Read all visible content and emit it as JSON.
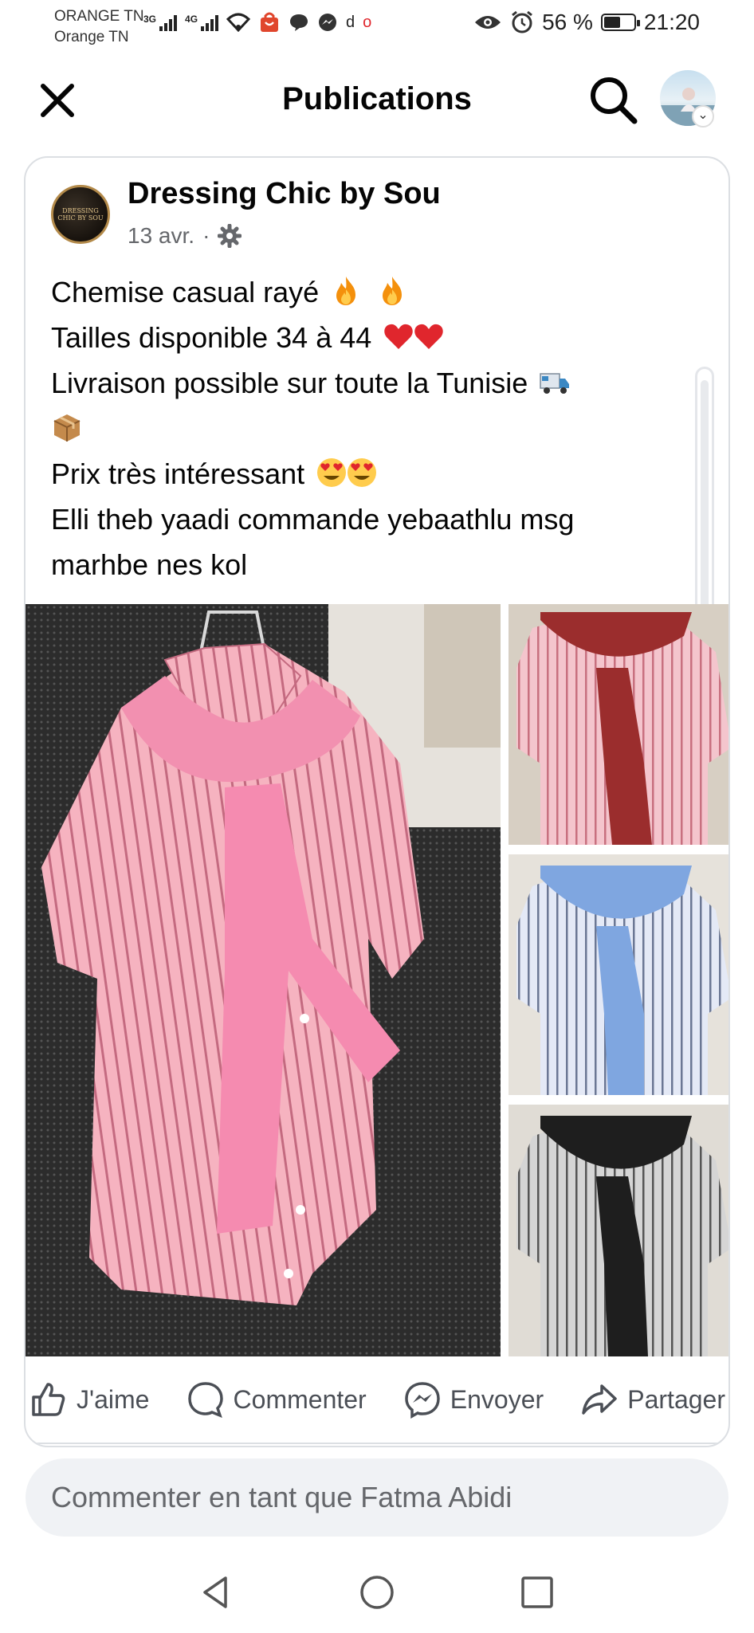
{
  "status_bar": {
    "carrier_line1": "ORANGE TN",
    "carrier_line2": "Orange TN",
    "signal1_label": "3G",
    "signal2_label": "4G",
    "battery_percent": "56 %",
    "battery_level": 0.56,
    "time": "21:20"
  },
  "header": {
    "title": "Publications"
  },
  "post": {
    "page_name": "Dressing Chic by Sou",
    "date": "13 avr.",
    "date_separator": "·",
    "logo_text": "DRESSING CHIC BY SOU",
    "lines": [
      "Chemise casual rayé",
      "Tailles disponible 34 à 44",
      "Livraison possible sur toute la Tunisie",
      "",
      "Prix très intéressant",
      "Elli theb yaadi commande yebaathlu msg",
      "marhbe nes kol"
    ],
    "photo_colors": {
      "main_shirt": "#f4a9b8",
      "main_scarf": "#f290b0",
      "thumb1_scarf": "#9b2d2d",
      "thumb2_scarf": "#7fa6e0",
      "thumb3_scarf": "#1e1e1e"
    }
  },
  "actions": {
    "like": "J'aime",
    "comment": "Commenter",
    "send": "Envoyer",
    "share": "Partager"
  },
  "comment_input": {
    "placeholder": "Commenter en tant que Fatma Abidi"
  }
}
